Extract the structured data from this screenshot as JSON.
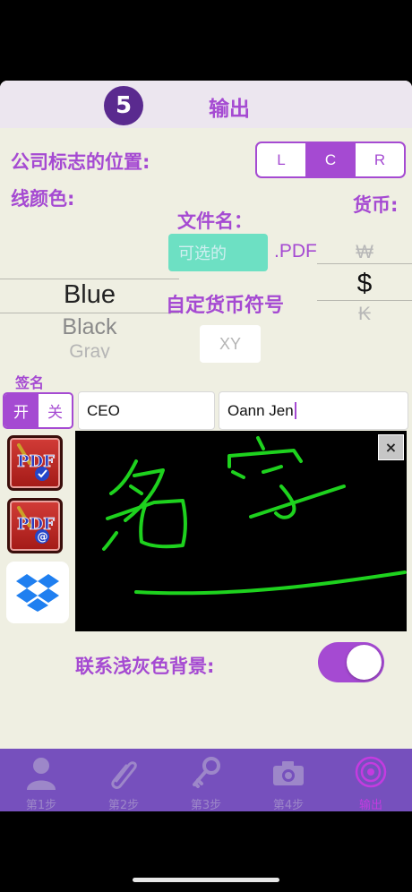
{
  "header": {
    "step_number": "5",
    "title": "输出"
  },
  "logo_position": {
    "label": "公司标志的位置:",
    "options": [
      "L",
      "C",
      "R"
    ],
    "selected": "C"
  },
  "line_color": {
    "label": "线颜色:",
    "options": [
      "Blue",
      "Black",
      "Gray"
    ],
    "selected": "Blue"
  },
  "filename": {
    "label": "文件名：",
    "placeholder": "可选的",
    "extension": ".PDF"
  },
  "currency": {
    "label": "货币:",
    "options": [
      "₩",
      "$",
      "₭"
    ],
    "selected": "$"
  },
  "custom_currency": {
    "label": "自定货币符号",
    "placeholder": "XY"
  },
  "signature": {
    "label": "签名",
    "toggle_on": "开",
    "toggle_off": "关",
    "selected": "开",
    "title_value": "CEO",
    "name_value": "Oann Jen"
  },
  "clear_icon": "×",
  "light_background": {
    "label": "联系浅灰色背景:",
    "on": true
  },
  "colors": {
    "accent": "#a54ad2",
    "tabbar": "#7650bd",
    "ink": "#1ed21e"
  },
  "tabs": [
    {
      "label": "第1步",
      "icon": "person-icon"
    },
    {
      "label": "第2步",
      "icon": "paperclip-icon"
    },
    {
      "label": "第3步",
      "icon": "key-icon"
    },
    {
      "label": "第4步",
      "icon": "camera-icon"
    },
    {
      "label": "输出",
      "icon": "target-icon",
      "active": true
    }
  ]
}
